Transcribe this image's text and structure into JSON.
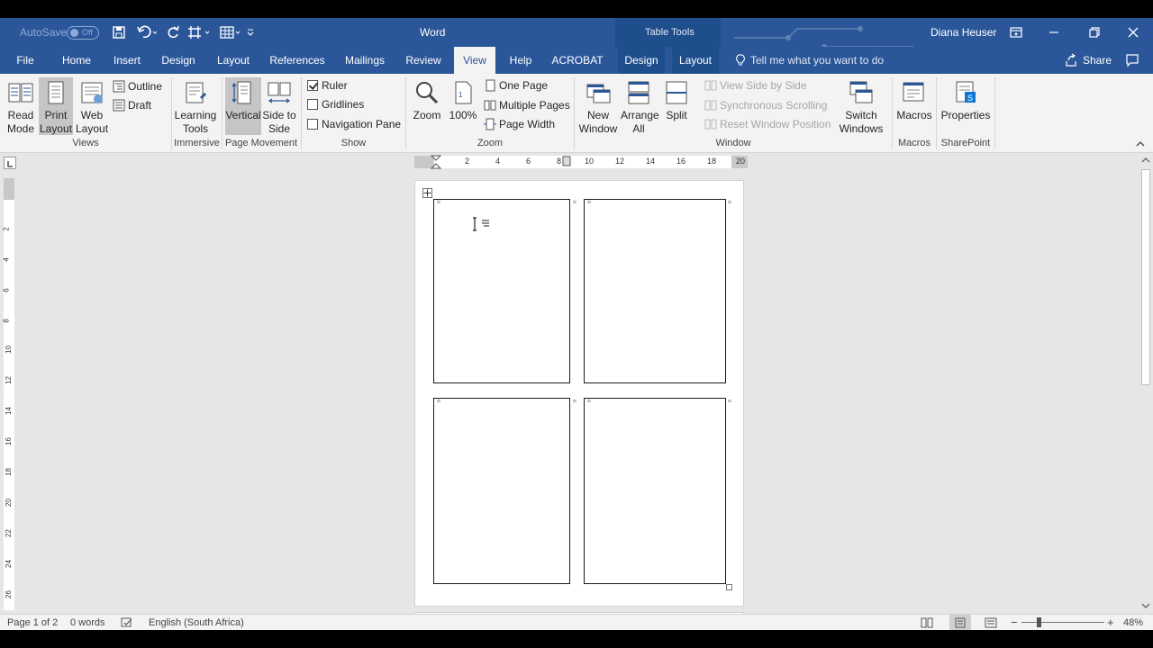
{
  "app": {
    "title": "Word",
    "contextual_title": "Table Tools",
    "user": "Diana Heuser",
    "autosave_label": "AutoSave",
    "autosave_state": "Off"
  },
  "tabs": [
    {
      "label": "File"
    },
    {
      "label": "Home"
    },
    {
      "label": "Insert"
    },
    {
      "label": "Design"
    },
    {
      "label": "Layout"
    },
    {
      "label": "References"
    },
    {
      "label": "Mailings"
    },
    {
      "label": "Review"
    },
    {
      "label": "View",
      "active": true
    },
    {
      "label": "Help"
    },
    {
      "label": "ACROBAT"
    },
    {
      "label": "Design"
    },
    {
      "label": "Layout"
    }
  ],
  "tell_me": "Tell me what you want to do",
  "share": "Share",
  "ribbon": {
    "views": {
      "label": "Views",
      "read_mode": "Read Mode",
      "print_layout": "Print Layout",
      "web_layout": "Web Layout",
      "outline": "Outline",
      "draft": "Draft"
    },
    "immersive": {
      "label": "Immersive",
      "learning_tools": "Learning Tools"
    },
    "page_movement": {
      "label": "Page Movement",
      "vertical": "Vertical",
      "side_to_side": "Side to Side"
    },
    "show": {
      "label": "Show",
      "ruler": "Ruler",
      "gridlines": "Gridlines",
      "navigation_pane": "Navigation Pane"
    },
    "zoom": {
      "label": "Zoom",
      "zoom": "Zoom",
      "hundred": "100%",
      "one_page": "One Page",
      "multiple_pages": "Multiple Pages",
      "page_width": "Page Width"
    },
    "window": {
      "label": "Window",
      "new_window": "New Window",
      "arrange_all": "Arrange All",
      "split": "Split",
      "view_side_by_side": "View Side by Side",
      "synchronous_scrolling": "Synchronous Scrolling",
      "reset_window_position": "Reset Window Position",
      "switch_windows": "Switch Windows"
    },
    "macros": {
      "label": "Macros",
      "macros": "Macros"
    },
    "sharepoint": {
      "label": "SharePoint",
      "properties": "Properties"
    }
  },
  "ruler": {
    "h_numbers": [
      "2",
      "4",
      "6",
      "8",
      "10",
      "12",
      "14",
      "16",
      "18",
      "20"
    ],
    "v_numbers": [
      "2",
      "4",
      "6",
      "8",
      "10",
      "12",
      "14",
      "16",
      "18",
      "20",
      "22",
      "24",
      "26"
    ]
  },
  "status": {
    "page": "Page 1 of 2",
    "words": "0 words",
    "language": "English (South Africa)",
    "zoom": "48%"
  },
  "colors": {
    "word_blue": "#2b579a",
    "ribbon_bg": "#f3f3f3",
    "workspace_bg": "#e6e6e6"
  }
}
